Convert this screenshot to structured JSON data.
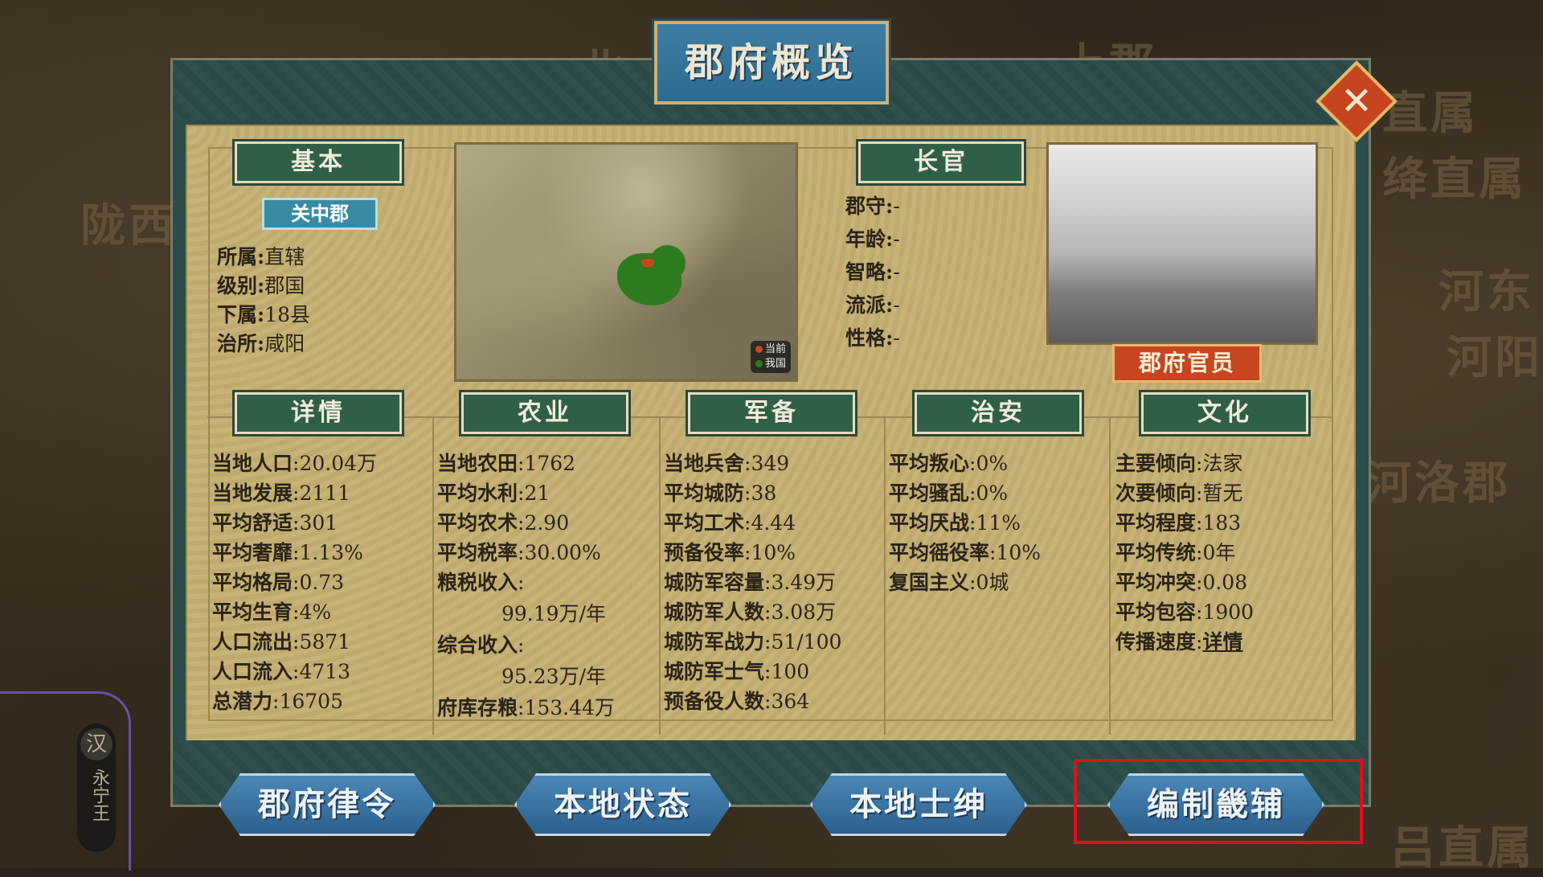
{
  "background": {
    "regions": [
      "陇西",
      "北",
      "上郡",
      "直属",
      "绛直属",
      "河东",
      "河阳",
      "河洛郡",
      "吕直属"
    ],
    "lord": {
      "initial": "汉",
      "name": "永宁王"
    }
  },
  "window": {
    "title": "郡府概览"
  },
  "basic": {
    "header": "基本",
    "commandery": "关中郡",
    "rows": [
      {
        "k": "所属",
        "v": "直辖"
      },
      {
        "k": "级别",
        "v": "郡国"
      },
      {
        "k": "下属",
        "v": "18县"
      },
      {
        "k": "治所",
        "v": "咸阳"
      }
    ]
  },
  "map_legend": {
    "current": "当前",
    "ours": "我国"
  },
  "colors": {
    "current": "#c8491e",
    "ours": "#2e7b1f",
    "accent_red": "#e0101a"
  },
  "governor": {
    "header": "长官",
    "rows": [
      {
        "k": "郡守",
        "v": "-"
      },
      {
        "k": "年龄",
        "v": "-"
      },
      {
        "k": "智略",
        "v": "-"
      },
      {
        "k": "流派",
        "v": "-"
      },
      {
        "k": "性格",
        "v": "-"
      }
    ],
    "officials_button": "郡府官员"
  },
  "sections": {
    "details": {
      "header": "详情",
      "rows": [
        {
          "k": "当地人口",
          "v": "20.04万"
        },
        {
          "k": "当地发展",
          "v": "2111"
        },
        {
          "k": "平均舒适",
          "v": "301"
        },
        {
          "k": "平均奢靡",
          "v": "1.13%"
        },
        {
          "k": "平均格局",
          "v": "0.73"
        },
        {
          "k": "平均生育",
          "v": "4%"
        },
        {
          "k": "人口流出",
          "v": "5871"
        },
        {
          "k": "人口流入",
          "v": "4713"
        },
        {
          "k": "总潜力",
          "v": "16705"
        }
      ]
    },
    "agriculture": {
      "header": "农业",
      "rows": [
        {
          "k": "当地农田",
          "v": "1762"
        },
        {
          "k": "平均水利",
          "v": "21"
        },
        {
          "k": "平均农术",
          "v": "2.90"
        },
        {
          "k": "平均税率",
          "v": "30.00%"
        }
      ],
      "grain_tax_label": "粮税收入",
      "grain_tax_value": "99.19万/年",
      "total_income_label": "综合收入",
      "total_income_value": "95.23万/年",
      "storage_label": "府库存粮",
      "storage_value": "153.44万"
    },
    "military": {
      "header": "军备",
      "rows": [
        {
          "k": "当地兵舍",
          "v": "349"
        },
        {
          "k": "平均城防",
          "v": "38"
        },
        {
          "k": "平均工术",
          "v": "4.44"
        },
        {
          "k": "预备役率",
          "v": "10%"
        },
        {
          "k": "城防军容量",
          "v": "3.49万"
        },
        {
          "k": "城防军人数",
          "v": "3.08万"
        },
        {
          "k": "城防军战力",
          "v": "51/100"
        },
        {
          "k": "城防军士气",
          "v": "100"
        },
        {
          "k": "预备役人数",
          "v": "364"
        }
      ]
    },
    "security": {
      "header": "治安",
      "rows": [
        {
          "k": "平均叛心",
          "v": "0%"
        },
        {
          "k": "平均骚乱",
          "v": "0%"
        },
        {
          "k": "平均厌战",
          "v": "11%"
        },
        {
          "k": "平均徭役率",
          "v": "10%"
        },
        {
          "k": "复国主义",
          "v": "0城"
        }
      ]
    },
    "culture": {
      "header": "文化",
      "rows": [
        {
          "k": "主要倾向",
          "v": "法家"
        },
        {
          "k": "次要倾向",
          "v": "暂无"
        },
        {
          "k": "平均程度",
          "v": "183"
        },
        {
          "k": "平均传统",
          "v": "0年"
        },
        {
          "k": "平均冲突",
          "v": "0.08"
        },
        {
          "k": "平均包容",
          "v": "1900"
        }
      ],
      "spread_label": "传播速度",
      "spread_link": "详情"
    }
  },
  "bottom_buttons": [
    "郡府律令",
    "本地状态",
    "本地士绅",
    "编制畿辅"
  ]
}
